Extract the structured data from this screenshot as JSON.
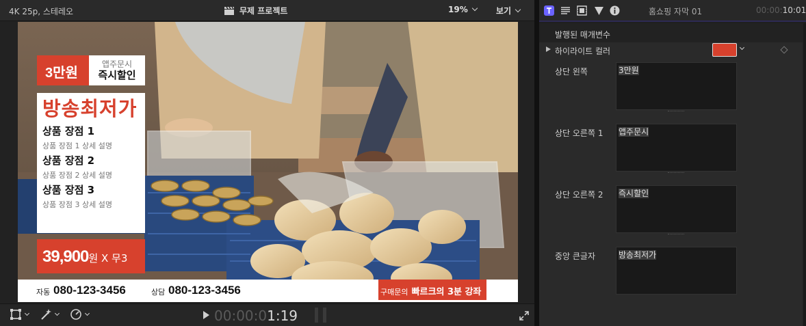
{
  "viewer": {
    "format": "4K 25p, 스테레오",
    "project_title": "무제 프로젝트",
    "zoom": "19%",
    "view_menu": "보기",
    "timecode_dim": "00:00:0",
    "timecode_bright": "1:19"
  },
  "overlay": {
    "price_tag": "3만원",
    "tag_line1": "앱주문시",
    "tag_line2": "즉시할인",
    "headline": "방송최저가",
    "points": [
      {
        "title": "상품 장점 1",
        "desc": "상품 장점 1 상세 설명"
      },
      {
        "title": "상품 장점 2",
        "desc": "상품 장점 2 상세 설명"
      },
      {
        "title": "상품 장점 3",
        "desc": "상품 장점 3 상세 설명"
      }
    ],
    "price_number": "39,900",
    "price_unit": "원 X 무3",
    "auto_label": "자동",
    "auto_phone": "080-123-3456",
    "consult_label": "상담",
    "consult_phone": "080-123-3456",
    "cta_small": "구매문의",
    "cta_big": "빠르크의 3분 강좌"
  },
  "inspector": {
    "title": "홈쇼핑 자막 01",
    "timecode_dim": "00:00:",
    "timecode_bright": "10:01",
    "section_title": "발행된 매개변수",
    "highlight_label": "하이라이트 컬러",
    "highlight_color": "#d7412d",
    "fields": [
      {
        "label": "상단 왼쪽",
        "value": "3만원"
      },
      {
        "label": "상단 오른쪽 1",
        "value": "앱주문시"
      },
      {
        "label": "상단 오른쪽 2",
        "value": "즉시할인"
      },
      {
        "label": "중앙 큰글자",
        "value": "방송최저가"
      }
    ]
  },
  "colors": {
    "accent_red": "#d7412d",
    "title_tab_active": "#6b63ff"
  }
}
